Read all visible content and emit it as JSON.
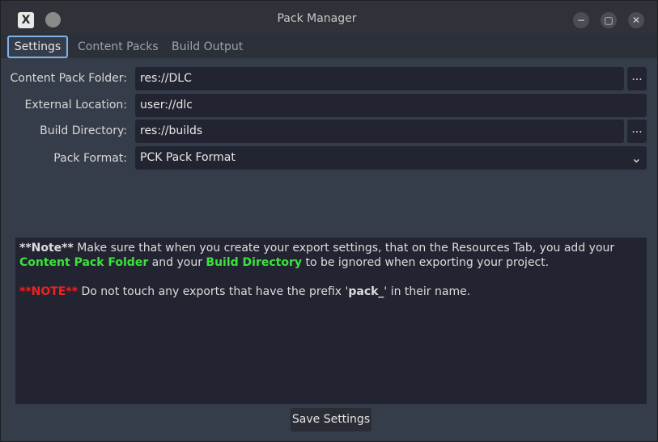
{
  "window": {
    "title": "Pack Manager",
    "minimize_icon": "minimize-icon",
    "maximize_icon": "maximize-icon",
    "close_icon": "close-icon"
  },
  "tabs": [
    {
      "label": "Settings",
      "active": true
    },
    {
      "label": "Content Packs",
      "active": false
    },
    {
      "label": "Build Output",
      "active": false
    }
  ],
  "form": {
    "content_pack_folder": {
      "label": "Content Pack Folder:",
      "value": "res://DLC",
      "browse": "..."
    },
    "external_location": {
      "label": "External Location:",
      "value": "user://dlc"
    },
    "build_directory": {
      "label": "Build Directory:",
      "value": "res://builds",
      "browse": "..."
    },
    "pack_format": {
      "label": "Pack Format:",
      "value": "PCK Pack Format"
    }
  },
  "note": {
    "p1_prefix": "**Note**",
    "p1_a": " Make sure that when you create your export settings, that on the Resources Tab, you add your ",
    "p1_hl1": "Content Pack Folder",
    "p1_b": " and your ",
    "p1_hl2": "Build Directory",
    "p1_c": " to be ignored when exporting your project.",
    "p2_prefix": "**NOTE**",
    "p2_a": " Do not touch any exports that have the prefix '",
    "p2_bold": "pack_",
    "p2_b": "' in their name."
  },
  "save_label": "Save Settings",
  "colors": {
    "highlight_green": "#3ce23c",
    "highlight_red": "#f02222",
    "active_tab_border": "#7fb2e8"
  }
}
